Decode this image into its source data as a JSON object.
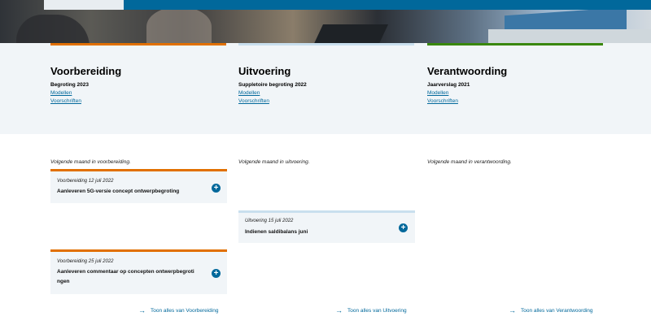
{
  "colors": {
    "orange": "#e17000",
    "lightblue": "#c9dfee",
    "green": "#39870c",
    "blue": "#01689b",
    "panel": "#f1f5f8"
  },
  "phases": [
    {
      "title": "Voorbereiding",
      "subtitle": "Begroting 2023",
      "link1": "Modellen",
      "link2": "Voorschriften"
    },
    {
      "title": "Uitvoering",
      "subtitle": "Suppletoire begroting 2022",
      "link1": "Modellen",
      "link2": "Voorschriften"
    },
    {
      "title": "Verantwoording",
      "subtitle": "Jaarverslag 2021",
      "link1": "Modellen",
      "link2": "Voorschriften"
    }
  ],
  "columns": [
    {
      "next_month": "Volgende maand in voorbereiding.",
      "cards": [
        {
          "meta": "Voorbereiding 12 juli 2022",
          "title": "Aanleveren 5G-versie concept ontwerpbegroting"
        },
        {
          "meta": "Voorbereiding 25 juli 2022",
          "title": "Aanleveren commentaar op concepten ontwerpbegroti ngen"
        }
      ],
      "show_all": "Toon alles van Voorbereiding"
    },
    {
      "next_month": "Volgende maand in uitvoering.",
      "cards": [
        {
          "meta": "Uitvoering 15 juli 2022",
          "title": "Indienen saldibalans juni"
        }
      ],
      "show_all": "Toon alles van Uitvoering"
    },
    {
      "next_month": "Volgende maand in verantwoording.",
      "cards": [],
      "show_all": "Toon alles van Verantwoording"
    }
  ],
  "icons": {
    "card_action": "plus-circle-icon",
    "show_all": "arrow-right-icon"
  }
}
